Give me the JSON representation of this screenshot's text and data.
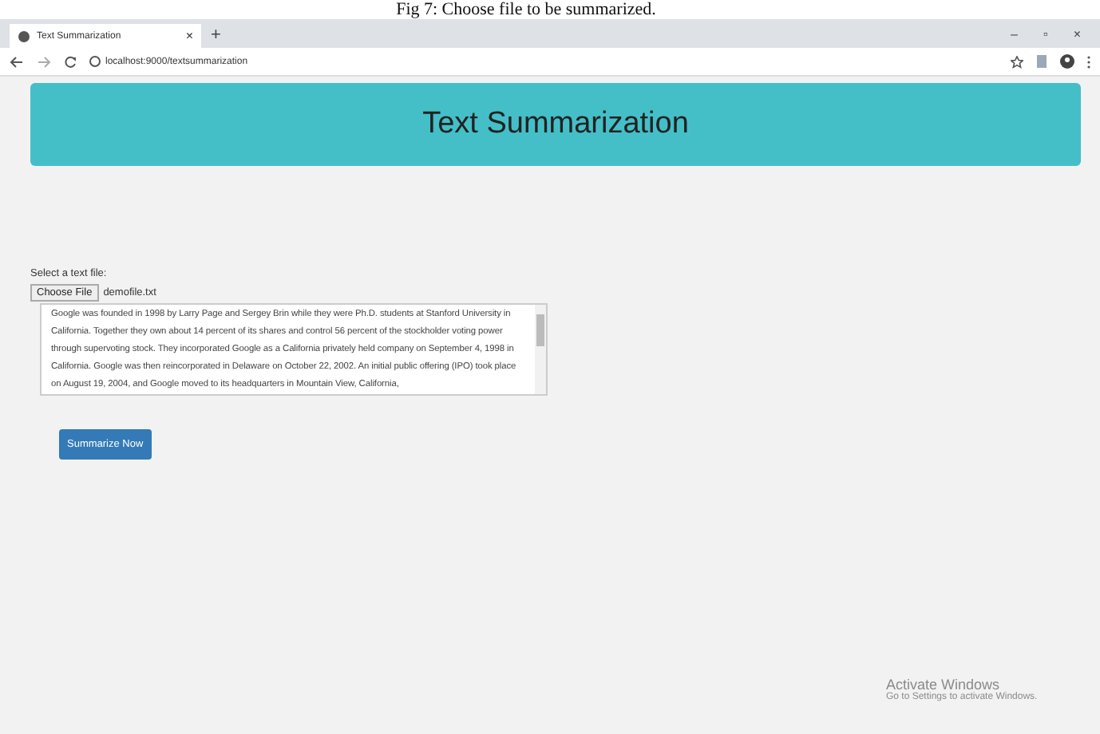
{
  "caption": "Fig 7: Choose file to be summarized.",
  "browser": {
    "tab_title": "Text Summarization",
    "tab_close": "×",
    "new_tab": "+",
    "window_controls": [
      "–",
      "▫",
      "×"
    ],
    "address": "localhost:9000/textsummarization"
  },
  "header": {
    "title": "Text Summarization"
  },
  "form": {
    "label": "Select a text file:",
    "choose_button": "Choose File",
    "file_name": "demofile.txt",
    "text": "Google was founded in 1998 by Larry Page and Sergey Brin while they were Ph.D. students at Stanford University in California. Together they own about 14 percent of its shares and control 56 percent of the stockholder voting power through supervoting stock. They incorporated Google as a California privately held company on September 4, 1998 in California. Google was then reincorporated in Delaware on October 22, 2002. An initial public offering (IPO) took place on August 19, 2004, and Google moved to its headquarters in Mountain View, California,",
    "submit_button": "Summarize Now"
  },
  "activation": {
    "title": "Activate Windows",
    "subtitle": "Go to Settings to activate Windows."
  }
}
